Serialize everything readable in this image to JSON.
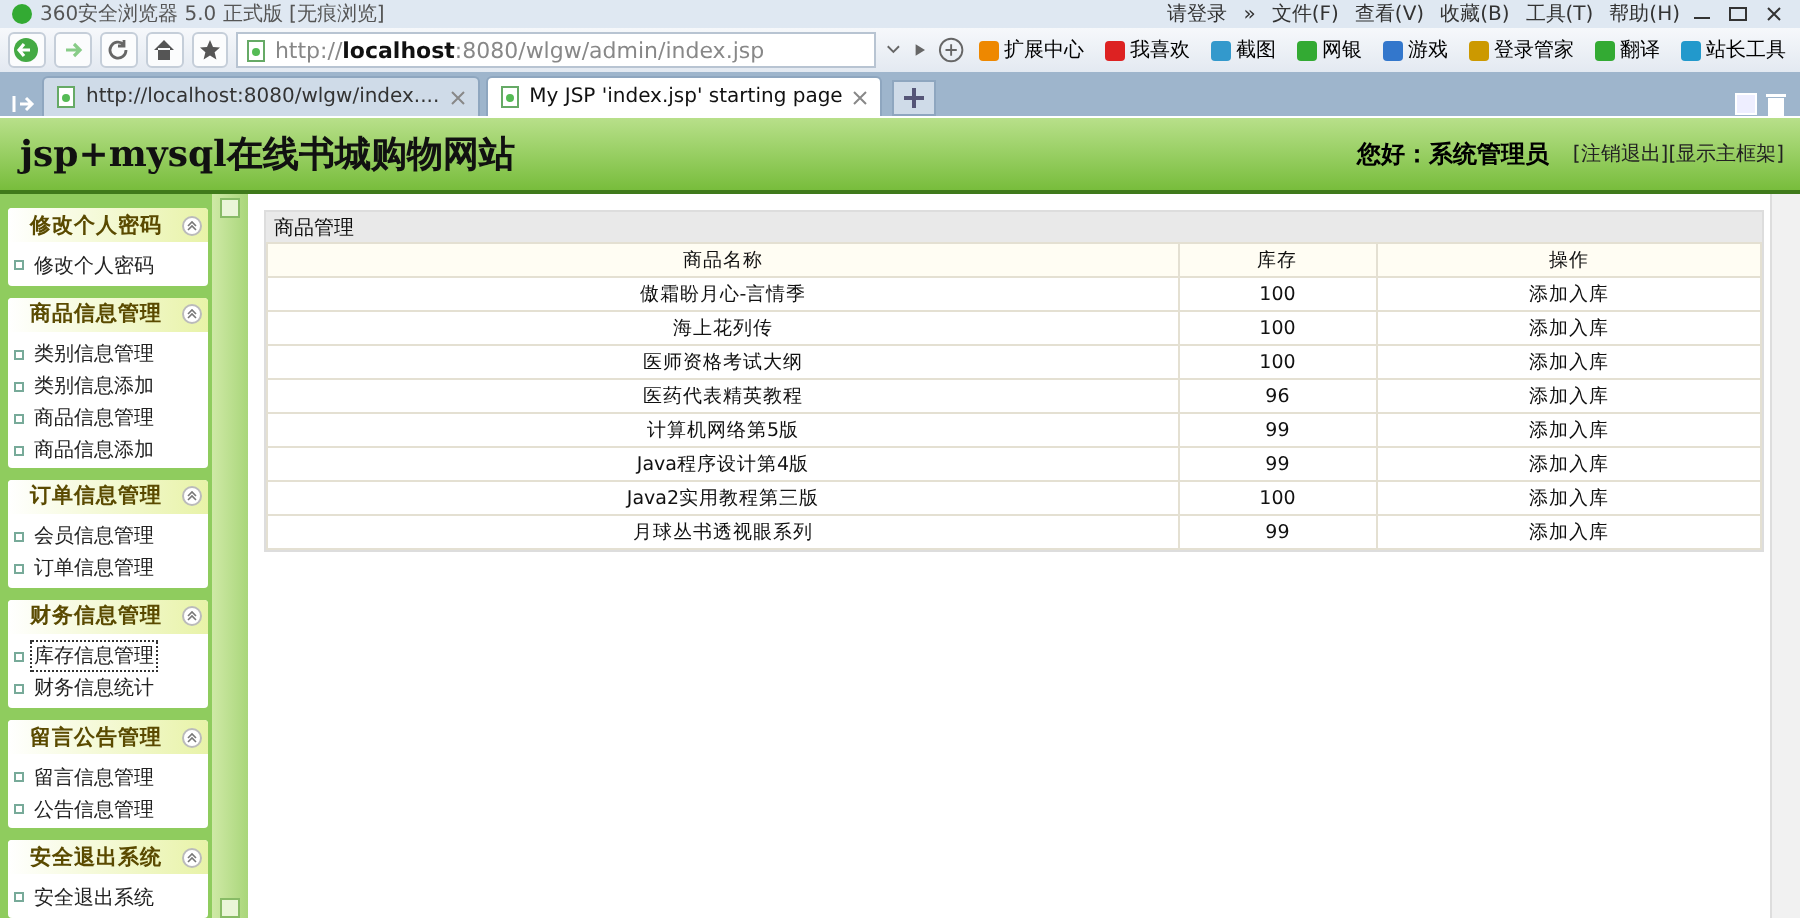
{
  "browser": {
    "title": "360安全浏览器 5.0 正式版 [无痕浏览]",
    "menu": [
      "请登录",
      "»",
      "文件(F)",
      "查看(V)",
      "收藏(B)",
      "工具(T)",
      "帮助(H)"
    ],
    "address": "http://**localhost**:8080/wlgw/admin/index.jsp",
    "toolbar": [
      "扩展中心",
      "我喜欢",
      "截图",
      "网银",
      "游戏",
      "登录管家",
      "翻译",
      "站长工具"
    ],
    "tabs": [
      {
        "label": "http://localhost:8080/wlgw/index....",
        "selected": false
      },
      {
        "label": "My JSP 'index.jsp' starting page",
        "selected": true
      }
    ]
  },
  "header": {
    "title": "jsp+mysql在线书城购物网站",
    "greeting": "您好：系统管理员",
    "links": [
      "[注销退出]",
      "[显示主框架]"
    ]
  },
  "sidebar": [
    {
      "title": "修改个人密码",
      "items": [
        {
          "label": "修改个人密码",
          "selected": false
        }
      ]
    },
    {
      "title": "商品信息管理",
      "items": [
        {
          "label": "类别信息管理",
          "selected": false
        },
        {
          "label": "类别信息添加",
          "selected": false
        },
        {
          "label": "商品信息管理",
          "selected": false
        },
        {
          "label": "商品信息添加",
          "selected": false
        }
      ]
    },
    {
      "title": "订单信息管理",
      "items": [
        {
          "label": "会员信息管理",
          "selected": false
        },
        {
          "label": "订单信息管理",
          "selected": false
        }
      ]
    },
    {
      "title": "财务信息管理",
      "items": [
        {
          "label": "库存信息管理",
          "selected": true
        },
        {
          "label": "财务信息统计",
          "selected": false
        }
      ]
    },
    {
      "title": "留言公告管理",
      "items": [
        {
          "label": "留言信息管理",
          "selected": false
        },
        {
          "label": "公告信息管理",
          "selected": false
        }
      ]
    },
    {
      "title": "安全退出系统",
      "items": [
        {
          "label": "安全退出系统",
          "selected": false
        }
      ]
    }
  ],
  "panel": {
    "title": "商品管理",
    "columns": [
      "商品名称",
      "库存",
      "操作"
    ],
    "rows": [
      [
        "傲霜盼月心-言情季",
        "100",
        "添加入库"
      ],
      [
        "海上花列传",
        "100",
        "添加入库"
      ],
      [
        "医师资格考试大纲",
        "100",
        "添加入库"
      ],
      [
        "医药代表精英教程",
        "96",
        "添加入库"
      ],
      [
        "计算机网络第5版",
        "99",
        "添加入库"
      ],
      [
        "Java程序设计第4版",
        "99",
        "添加入库"
      ],
      [
        "Java2实用教程第三版",
        "100",
        "添加入库"
      ],
      [
        "月球丛书透视眼系列",
        "99",
        "添加入库"
      ]
    ]
  }
}
